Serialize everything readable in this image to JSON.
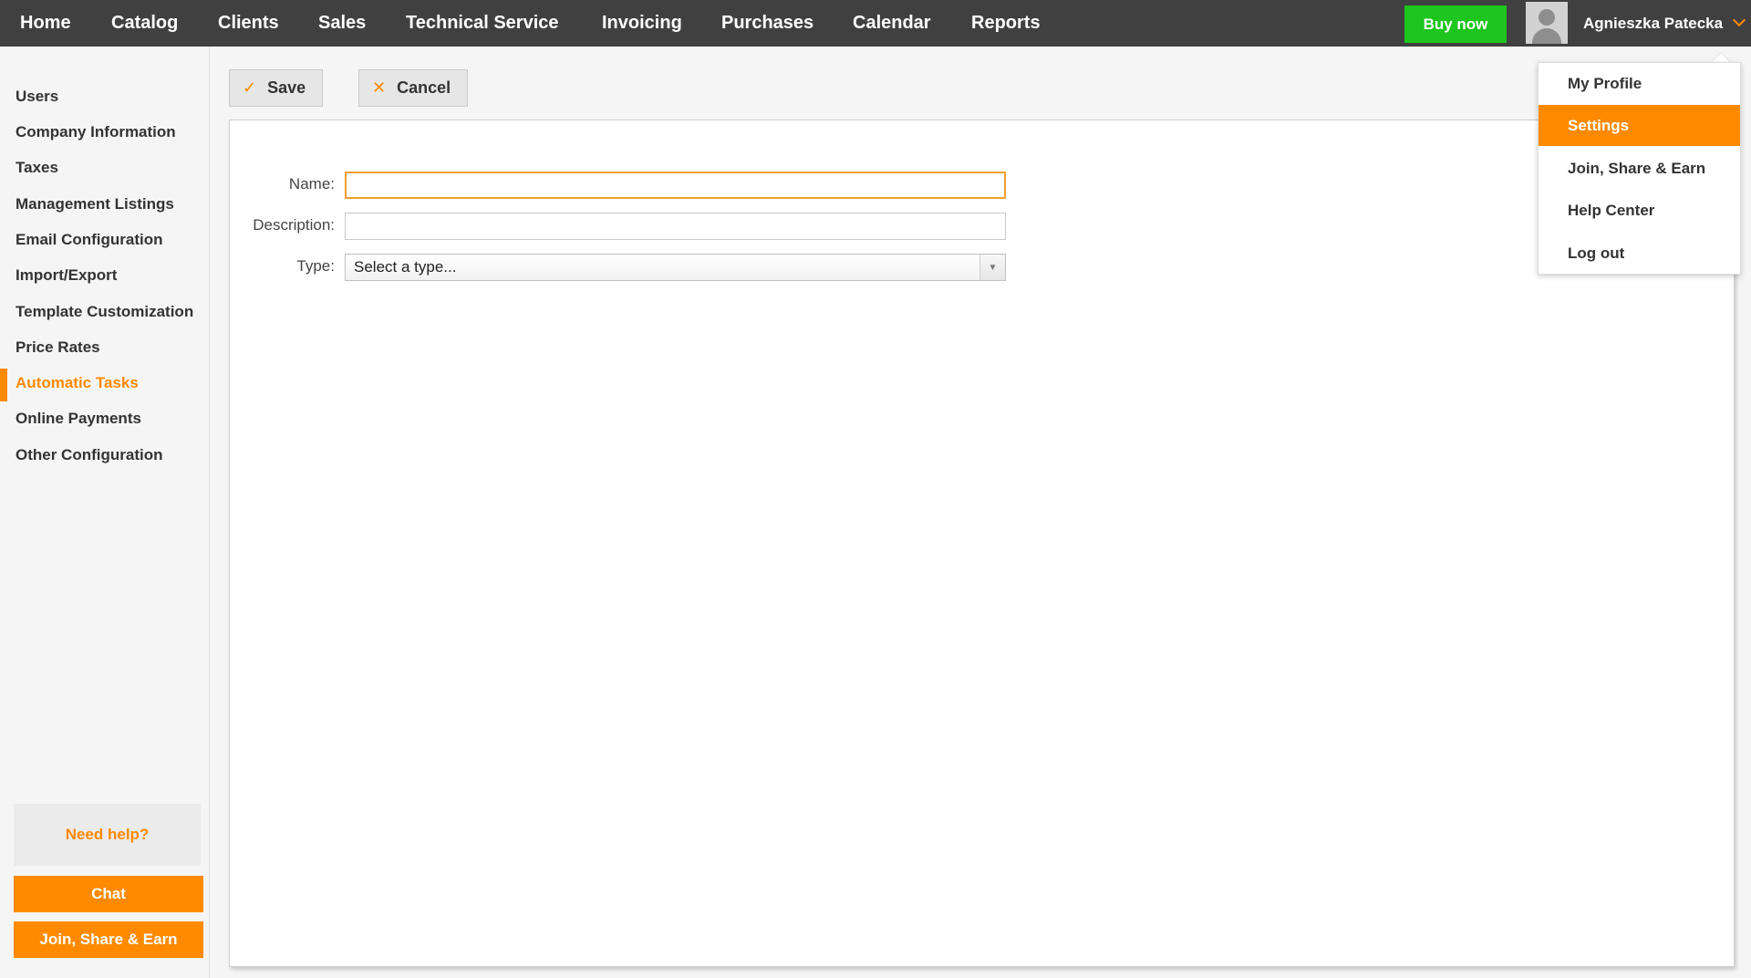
{
  "nav": {
    "items": [
      "Home",
      "Catalog",
      "Clients",
      "Sales",
      "Technical Service",
      "Invoicing",
      "Purchases",
      "Calendar",
      "Reports"
    ],
    "buy_now": "Buy now",
    "user_name": "Agnieszka Patecka"
  },
  "user_menu": {
    "items": [
      "My Profile",
      "Settings",
      "Join, Share & Earn",
      "Help Center",
      "Log out"
    ],
    "active": "Settings"
  },
  "sidebar": {
    "items": [
      "Users",
      "Company Information",
      "Taxes",
      "Management Listings",
      "Email Configuration",
      "Import/Export",
      "Template Customization",
      "Price Rates",
      "Automatic Tasks",
      "Online Payments",
      "Other Configuration"
    ],
    "active": "Automatic Tasks",
    "help": "Need help?",
    "chat": "Chat",
    "join": "Join, Share & Earn"
  },
  "toolbar": {
    "save_label": "Save",
    "cancel_label": "Cancel",
    "save_icon": "checkmark-icon",
    "cancel_icon": "close-icon"
  },
  "form": {
    "name_label": "Name:",
    "name_value": "",
    "description_label": "Description:",
    "description_value": "",
    "type_label": "Type:",
    "type_selected": "Select a type..."
  },
  "colors": {
    "accent": "#ff8a00",
    "topbar": "#404040",
    "buy_button": "#1ec51e"
  }
}
